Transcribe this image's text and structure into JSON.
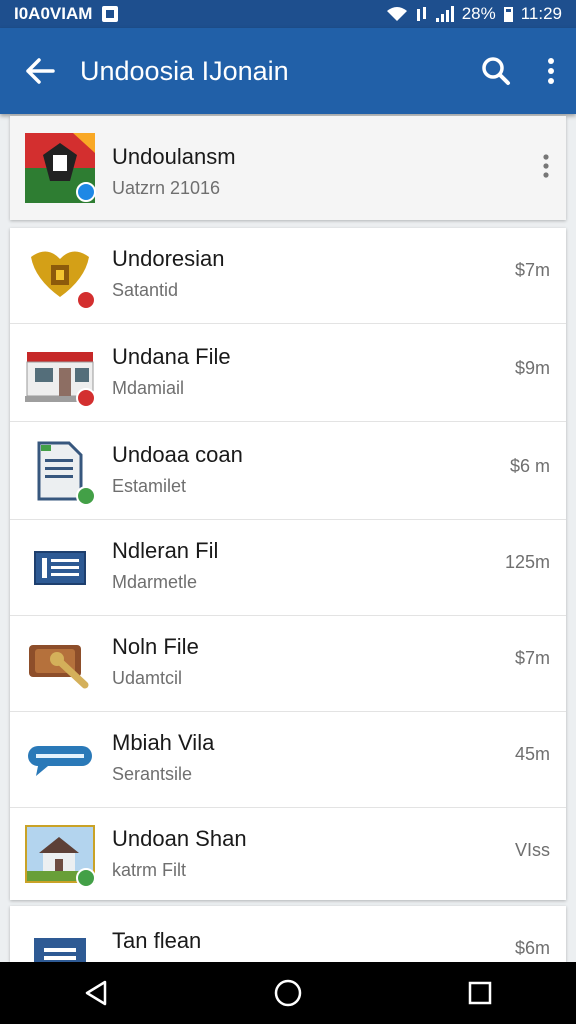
{
  "status_bar": {
    "left_text": "I0A0VIAM",
    "battery_percent": "28%",
    "time": "11:29"
  },
  "app_bar": {
    "title": "Undoosia IJonain",
    "icons": [
      "back-arrow-icon",
      "search-icon",
      "more-vert-icon"
    ]
  },
  "featured": {
    "title": "Undoulansm",
    "subtitle": "Uatzrn 21016",
    "icon": "flag-emblem-icon"
  },
  "files": [
    {
      "title": "Undoresian",
      "subtitle": "Satantid",
      "size": "$7m",
      "icon": "garuda-emblem-icon"
    },
    {
      "title": "Undana File",
      "subtitle": "Mdamiail",
      "size": "$9m",
      "icon": "storefront-icon"
    },
    {
      "title": "Undoaa coan",
      "subtitle": "Estamilet",
      "size": "$6 m",
      "icon": "document-icon"
    },
    {
      "title": "Ndleran Fil",
      "subtitle": "Mdarmetle",
      "size": "125m",
      "icon": "list-icon"
    },
    {
      "title": "Noln File",
      "subtitle": "Udamtcil",
      "size": "$7m",
      "icon": "wallet-key-icon"
    },
    {
      "title": "Mbiah Vila",
      "subtitle": "Serantsile",
      "size": "45m",
      "icon": "chat-bubble-icon"
    },
    {
      "title": "Undoan Shan",
      "subtitle": "katrm Filt",
      "size": "VIss",
      "icon": "house-photo-icon"
    },
    {
      "title": "Tan flean",
      "subtitle": "",
      "size": "$6m",
      "icon": "document-blue-icon"
    }
  ],
  "colors": {
    "status_bar": "#1e4f8e",
    "app_bar": "#2160a8",
    "background": "#eceff1"
  }
}
